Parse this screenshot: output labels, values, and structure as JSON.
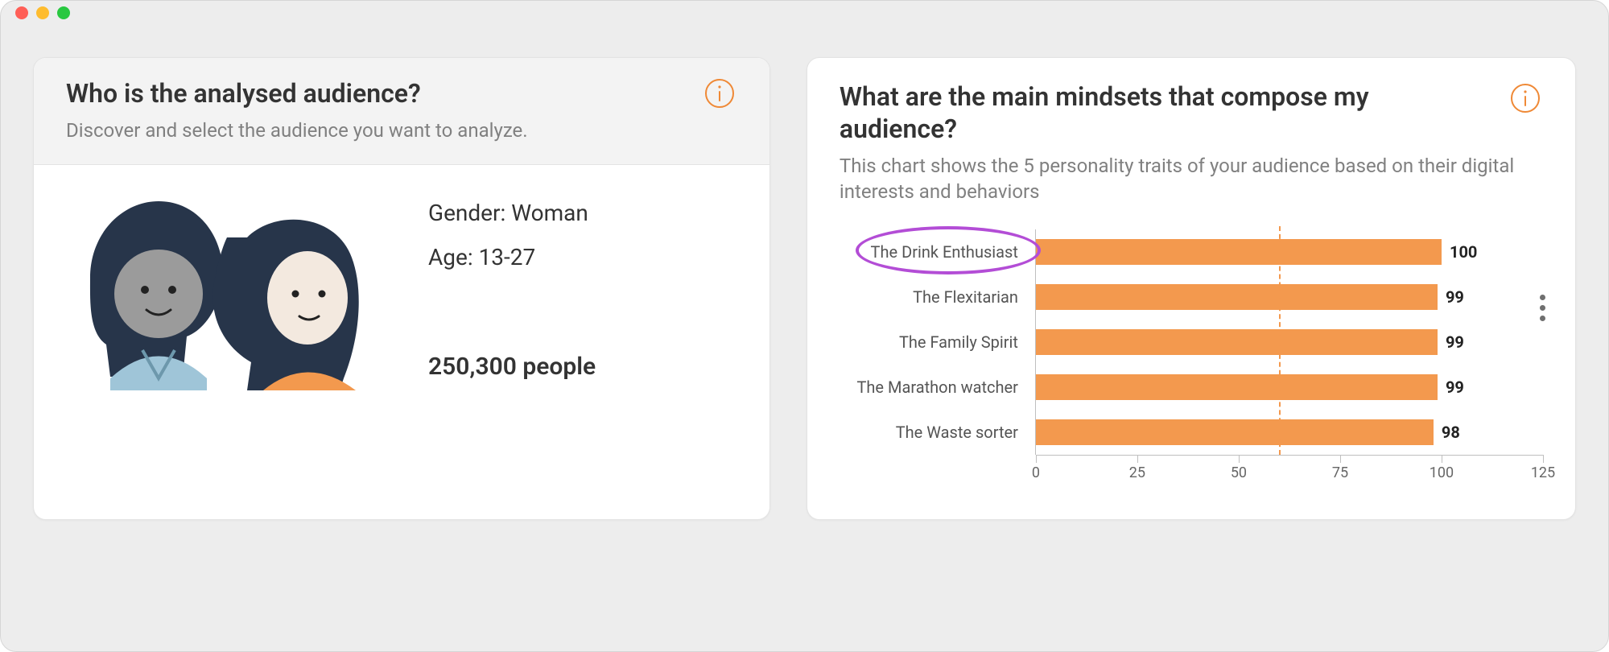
{
  "colors": {
    "accent": "#f3994e",
    "highlight": "#b34dd6"
  },
  "left_card": {
    "title": "Who is the analysed audience?",
    "subtitle": "Discover and select the audience you want to analyze.",
    "gender_label": "Gender: Woman",
    "age_label": "Age: 13-27",
    "count": "250,300 people"
  },
  "right_card": {
    "title": "What are the main mindsets that compose my audience?",
    "subtitle": "This chart shows the 5 personality traits of your audience based on their digital interests and behaviors"
  },
  "chart_data": {
    "type": "bar",
    "orientation": "horizontal",
    "title": "What are the main mindsets that compose my audience?",
    "xlabel": "",
    "ylabel": "",
    "xlim": [
      0,
      125
    ],
    "xticks": [
      0,
      25,
      50,
      75,
      100,
      125
    ],
    "reference_line_x": 60,
    "highlighted_category": "The Drink Enthusiast",
    "categories": [
      "The Drink Enthusiast",
      "The Flexitarian",
      "The Family Spirit",
      "The Marathon watcher",
      "The Waste sorter"
    ],
    "values": [
      100,
      99,
      99,
      99,
      98
    ]
  }
}
